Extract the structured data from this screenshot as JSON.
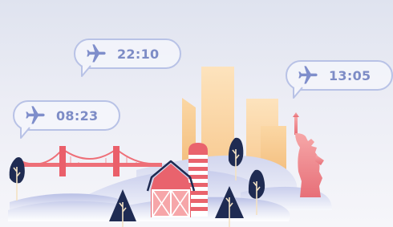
{
  "flight_bubbles": [
    {
      "time": "22:10",
      "icon": "airplane-icon"
    },
    {
      "time": "08:23",
      "icon": "airplane-icon"
    },
    {
      "time": "13:05",
      "icon": "airplane-icon"
    }
  ],
  "landmarks": [
    "golden-gate-bridge",
    "red-barn",
    "silo",
    "city-skyline",
    "statue-of-liberty"
  ],
  "colors": {
    "sky_top": "#dfe3ef",
    "bubble_border": "#b8c2e6",
    "time_text": "#7d8cc6",
    "bridge": "#ee6f78",
    "barn": "#e9636d",
    "skyline": "#fcd9a8",
    "statue": "#ec8f93",
    "tree_dark": "#1f2b52",
    "hill_blue": "#c3c9e9"
  }
}
